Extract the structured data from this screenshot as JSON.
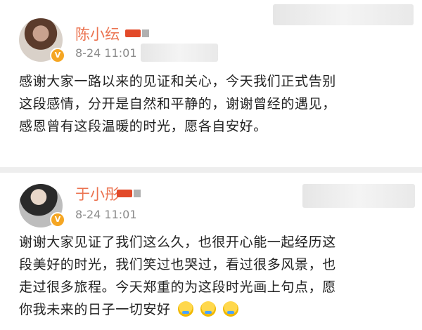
{
  "posts": [
    {
      "author": "陈小纭",
      "time": "8-24 11:01",
      "lines": [
        "感谢大家一路以来的见证和关心，今天我们正式告别",
        "这段感情，分开是自然和平静的，谢谢曾经的遇见，",
        "感恩曾有这段温暖的时光，愿各自安好。"
      ]
    },
    {
      "author": "于小彤",
      "time": "8-24 11:01",
      "lines": [
        "谢谢大家见证了我们这么久，也很开心能一起经历这",
        "段美好的时光，我们笑过也哭过，看过很多风景，也",
        "走过很多旅程。今天郑重的为这段时光画上句点，愿",
        "你我未来的日子一切安好"
      ],
      "emoji_count": 3
    }
  ],
  "colors": {
    "name": "#eb7350",
    "time": "#8a8a8a",
    "badge": "#e24a2a",
    "verify": "#f5a623"
  },
  "icons": {
    "verify": "verified-badge-icon",
    "member": "member-badge-icon",
    "emoji": "emoji-icon"
  }
}
